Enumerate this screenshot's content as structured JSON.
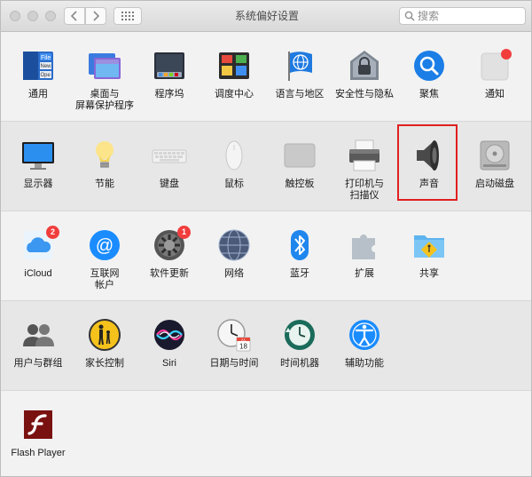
{
  "window": {
    "title": "系统偏好设置",
    "search_placeholder": "搜索"
  },
  "sections": [
    {
      "items": [
        {
          "id": "general",
          "label": "通用",
          "icon": "general-icon"
        },
        {
          "id": "desktop",
          "label": "桌面与\n屏幕保护程序",
          "icon": "desktop-screensaver-icon"
        },
        {
          "id": "dock",
          "label": "程序坞",
          "icon": "dock-icon"
        },
        {
          "id": "mission",
          "label": "调度中心",
          "icon": "mission-control-icon"
        },
        {
          "id": "language",
          "label": "语言与地区",
          "icon": "language-region-icon"
        },
        {
          "id": "security",
          "label": "安全性与隐私",
          "icon": "security-privacy-icon"
        },
        {
          "id": "spotlight",
          "label": "聚焦",
          "icon": "spotlight-icon"
        },
        {
          "id": "notifications",
          "label": "通知",
          "icon": "notifications-icon"
        }
      ]
    },
    {
      "items": [
        {
          "id": "displays",
          "label": "显示器",
          "icon": "display-icon"
        },
        {
          "id": "energy",
          "label": "节能",
          "icon": "energy-saver-icon"
        },
        {
          "id": "keyboard",
          "label": "键盘",
          "icon": "keyboard-icon"
        },
        {
          "id": "mouse",
          "label": "鼠标",
          "icon": "mouse-icon"
        },
        {
          "id": "trackpad",
          "label": "触控板",
          "icon": "trackpad-icon"
        },
        {
          "id": "printers",
          "label": "打印机与\n扫描仪",
          "icon": "printer-icon"
        },
        {
          "id": "sound",
          "label": "声音",
          "icon": "speaker-icon"
        },
        {
          "id": "startup",
          "label": "启动磁盘",
          "icon": "startup-disk-icon"
        }
      ]
    },
    {
      "items": [
        {
          "id": "icloud",
          "label": "iCloud",
          "icon": "icloud-icon",
          "badge": "2"
        },
        {
          "id": "internet",
          "label": "互联网\n帐户",
          "icon": "internet-accounts-icon"
        },
        {
          "id": "update",
          "label": "软件更新",
          "icon": "software-update-icon",
          "badge": "1"
        },
        {
          "id": "network",
          "label": "网络",
          "icon": "network-icon"
        },
        {
          "id": "bluetooth",
          "label": "蓝牙",
          "icon": "bluetooth-icon"
        },
        {
          "id": "extensions",
          "label": "扩展",
          "icon": "extensions-icon"
        },
        {
          "id": "sharing",
          "label": "共享",
          "icon": "sharing-icon"
        }
      ]
    },
    {
      "items": [
        {
          "id": "users",
          "label": "用户与群组",
          "icon": "users-groups-icon"
        },
        {
          "id": "parental",
          "label": "家长控制",
          "icon": "parental-controls-icon"
        },
        {
          "id": "siri",
          "label": "Siri",
          "icon": "siri-icon"
        },
        {
          "id": "datetime",
          "label": "日期与时间",
          "icon": "date-time-icon"
        },
        {
          "id": "timemachine",
          "label": "时间机器",
          "icon": "time-machine-icon"
        },
        {
          "id": "accessibility",
          "label": "辅助功能",
          "icon": "accessibility-icon"
        }
      ]
    },
    {
      "items": [
        {
          "id": "flash",
          "label": "Flash Player",
          "icon": "flash-player-icon"
        }
      ]
    }
  ],
  "date_icon": {
    "month": "JUL",
    "day": "18"
  },
  "colors": {
    "accent_blue": "#1a8cff",
    "badge_red": "#f23d3d",
    "highlight_red": "#e02020"
  }
}
